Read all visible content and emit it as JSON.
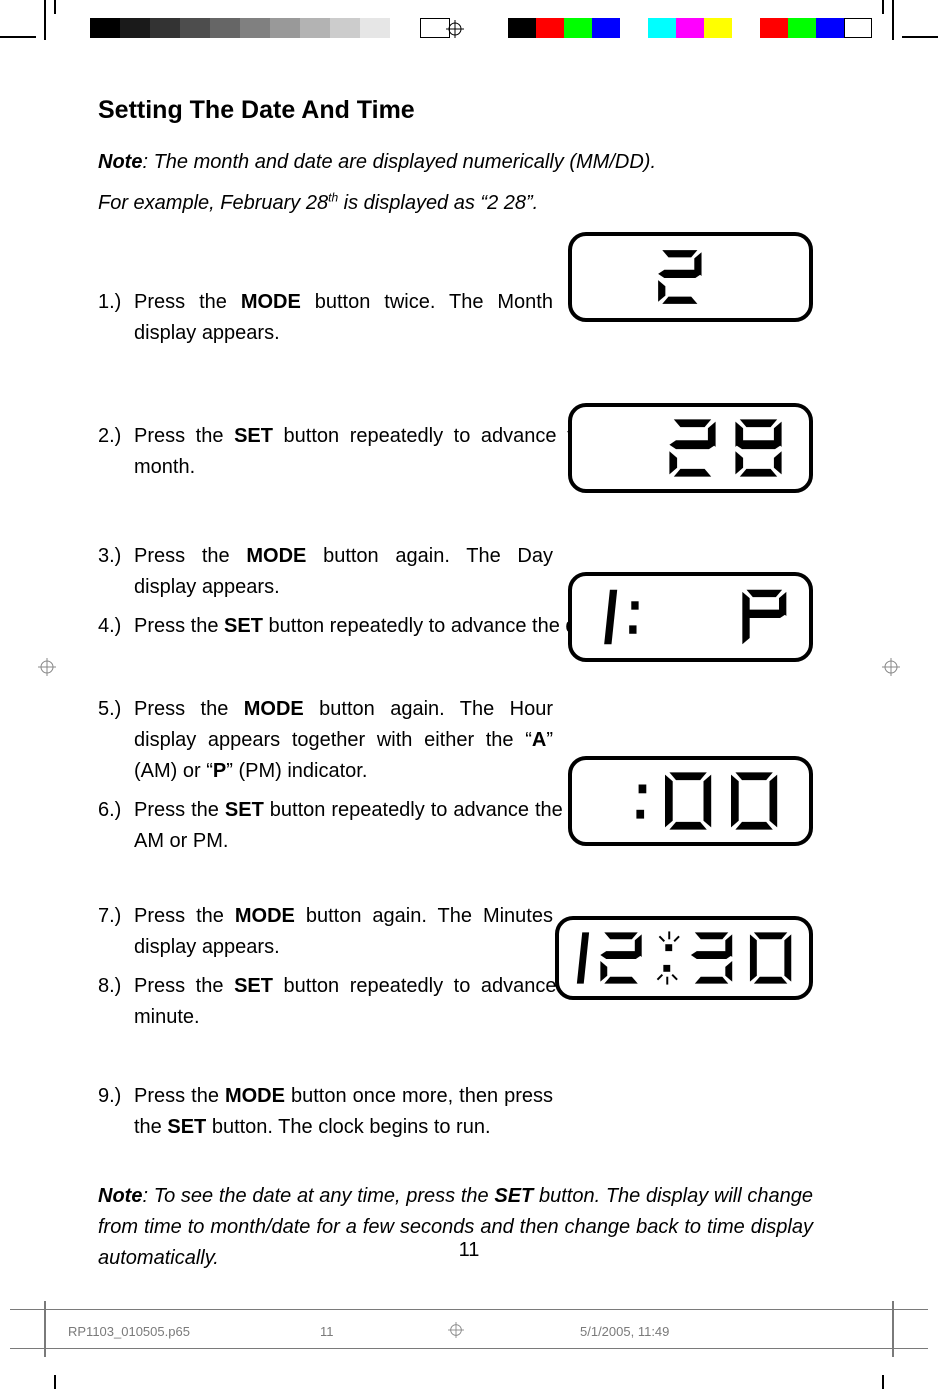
{
  "title": "Setting The Date And Time",
  "note1_prefix": "Note",
  "note1_body": ": The month and date are displayed numerically (MM/DD).",
  "note1_line2_a": "For example, February 28",
  "note1_line2_sup": "th",
  "note1_line2_b": " is displayed as “2  28”.",
  "steps": {
    "1": {
      "num": "1.)",
      "a": "Press the ",
      "b1": "MODE",
      "c": " button twice. The Month display appears."
    },
    "2": {
      "num": "2.)",
      "a": "Press the ",
      "b1": "SET",
      "c": " button repeatedly to advance the display to the correct month."
    },
    "3": {
      "num": "3.)",
      "a": "Press the ",
      "b1": "MODE",
      "c": " button again. The Day display appears."
    },
    "4": {
      "num": "4.)",
      "a": "Press the ",
      "b1": "SET",
      "c": " button repeatedly to advance the display to the correct day."
    },
    "5": {
      "num": "5.)",
      "a": "Press the ",
      "b1": "MODE",
      "c": " button again. The Hour display appears together with either the “",
      "b2": "A",
      "d": "” (AM) or “",
      "b3": "P",
      "e": "” (PM) indicator."
    },
    "6": {
      "num": "6.)",
      "a": "Press the ",
      "b1": "SET",
      "c": " button repeatedly to advance the display to the correct hour, AM or PM."
    },
    "7": {
      "num": "7.)",
      "a": "Press the ",
      "b1": "MODE",
      "c": " button again. The Minutes display appears."
    },
    "8": {
      "num": "8.)",
      "a": "Press the ",
      "b1": "SET",
      "c": " button repeatedly to advance the display to the correct minute."
    },
    "9": {
      "num": "9.)",
      "a": "Press the ",
      "b1": "MODE",
      "c": " button once more, then press the ",
      "b2": "SET",
      "d": " button. The clock begins to run."
    }
  },
  "note2_prefix": "Note",
  "note2_a": ": To see the date at any time, press the ",
  "note2_b": "SET",
  "note2_c": " button. The display will change from time to month/date for a few seconds and then change back to time display automatically.",
  "lcd": {
    "month": "2",
    "day": "28",
    "hour": "1:  P",
    "minutes": ":00",
    "clock": "12:30"
  },
  "page_number": "11",
  "footer": {
    "filename": "RP1103_010505.p65",
    "sheet": "11",
    "datetime": "5/1/2005, 11:49"
  },
  "color_bars_left": [
    "#000000",
    "#1a1a1a",
    "#333333",
    "#4d4d4d",
    "#666666",
    "#808080",
    "#999999",
    "#b3b3b3",
    "#cccccc",
    "#e6e6e6",
    "#ffffff"
  ],
  "color_bars_right": [
    "#000000",
    "#ff0000",
    "#00ff00",
    "#0000ff",
    "#ffffff",
    "#00ffff",
    "#ff00ff",
    "#ffff00",
    "#ffffff",
    "#ff0000",
    "#00ff00",
    "#0000ff"
  ]
}
